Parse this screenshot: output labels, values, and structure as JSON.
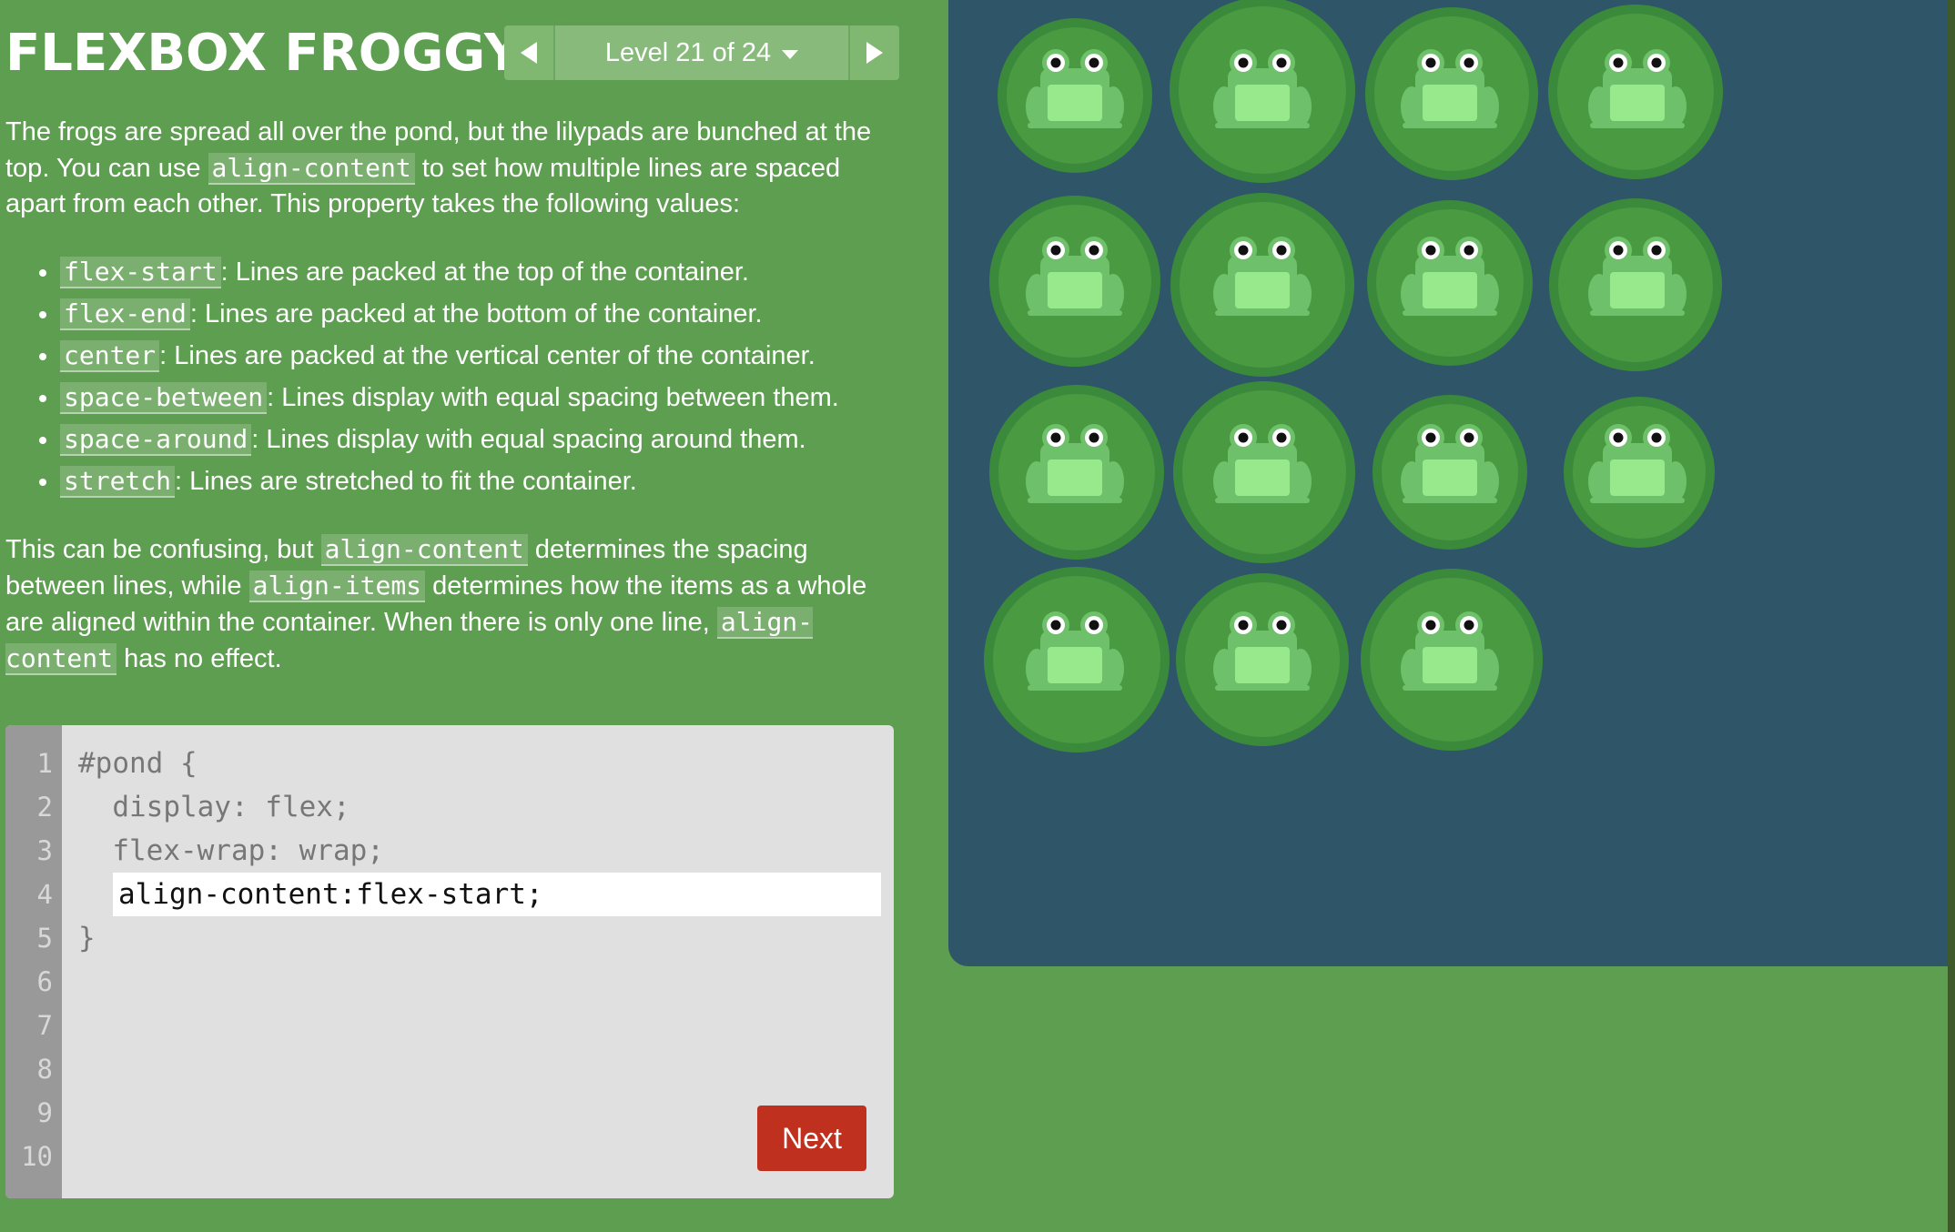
{
  "header": {
    "title": "FLEXBOX FROGGY",
    "level_label": "Level 21 of 24"
  },
  "instructions": {
    "intro_1": "The frogs are spread all over the pond, but the lilypads are bunched at the top. You can use ",
    "intro_code": "align-content",
    "intro_2": " to set how multiple lines are spaced apart from each other. This property takes the following values:",
    "values": [
      {
        "code": "flex-start",
        "desc": ": Lines are packed at the top of the container."
      },
      {
        "code": "flex-end",
        "desc": ": Lines are packed at the bottom of the container."
      },
      {
        "code": "center",
        "desc": ": Lines are packed at the vertical center of the container."
      },
      {
        "code": "space-between",
        "desc": ": Lines display with equal spacing between them."
      },
      {
        "code": "space-around",
        "desc": ": Lines display with equal spacing around them."
      },
      {
        "code": "stretch",
        "desc": ": Lines are stretched to fit the container."
      }
    ],
    "note_1": "This can be confusing, but ",
    "note_code_1": "align-content",
    "note_2": " determines the spacing between lines, while ",
    "note_code_2": "align-items",
    "note_3": " determines how the items as a whole are aligned within the container. When there is only one line, ",
    "note_code_3": "align-content",
    "note_4": " has no effect."
  },
  "editor": {
    "line_numbers": [
      "1",
      "2",
      "3",
      "4",
      "5",
      "6",
      "7",
      "8",
      "9",
      "10"
    ],
    "line_1": "#pond {",
    "line_2": "  display: flex;",
    "line_3": "  flex-wrap: wrap;",
    "input_value": "align-content:flex-start;",
    "line_5": "}",
    "next_label": "Next"
  },
  "pond": {
    "frog_count": 15,
    "colors": {
      "background": "#2e5568",
      "lilypad": "#4a9a42",
      "frog": "#6ec06a",
      "frog_belly": "#98e88c",
      "page_green": "#5e9e50",
      "next_button": "#c0301f"
    }
  }
}
